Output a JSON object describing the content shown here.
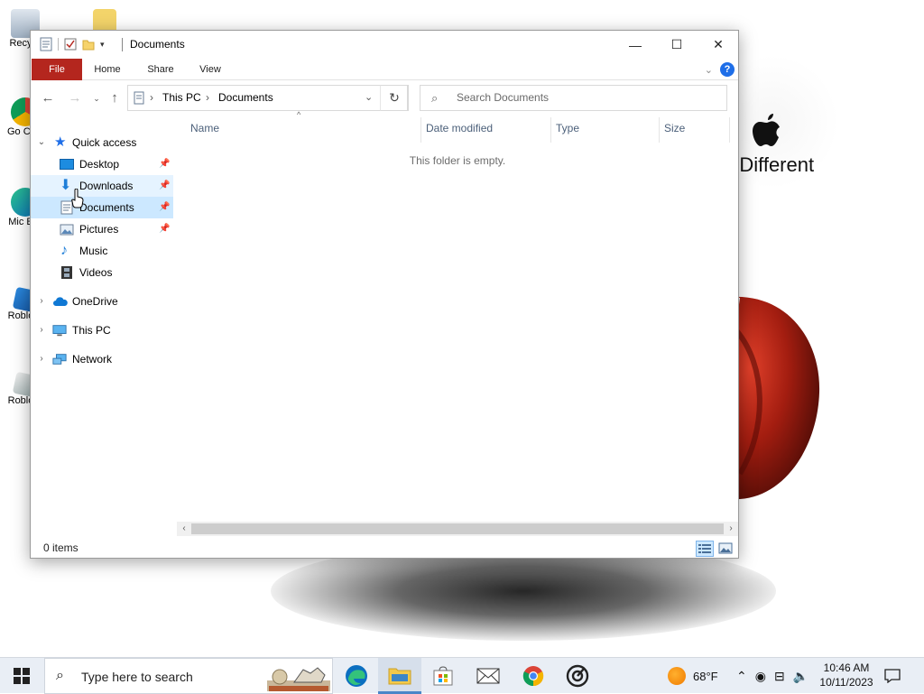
{
  "desktop": {
    "icons": [
      {
        "label": "Recy",
        "name": "recycle-bin"
      },
      {
        "label": "Go Chr",
        "name": "google-chrome"
      },
      {
        "label": "Mic E",
        "name": "microsoft-edge"
      },
      {
        "label": "Roblo",
        "name": "roblox-player"
      },
      {
        "label": "Roblo",
        "name": "roblox-studio"
      }
    ],
    "wallpaper_text": "nk Different"
  },
  "window": {
    "title": "Documents",
    "controls": {
      "minimize": "—",
      "maximize": "☐",
      "close": "✕"
    },
    "ribbon_tabs": [
      "File",
      "Home",
      "Share",
      "View"
    ],
    "help_label": "?",
    "address": {
      "root_label": "This PC",
      "current_label": "Documents",
      "separator": "›"
    },
    "search_placeholder": "Search Documents",
    "nav_pane": [
      {
        "label": "Quick access",
        "level": 0,
        "icon": "star-icon",
        "expanded": true
      },
      {
        "label": "Desktop",
        "level": 1,
        "icon": "desktop-folder-icon",
        "pinned": true
      },
      {
        "label": "Downloads",
        "level": 1,
        "icon": "download-arrow-icon",
        "pinned": true,
        "state": "hover"
      },
      {
        "label": "Documents",
        "level": 1,
        "icon": "documents-folder-icon",
        "pinned": true,
        "state": "selected"
      },
      {
        "label": "Pictures",
        "level": 1,
        "icon": "pictures-folder-icon",
        "pinned": true
      },
      {
        "label": "Music",
        "level": 1,
        "icon": "music-note-icon"
      },
      {
        "label": "Videos",
        "level": 1,
        "icon": "videos-folder-icon"
      },
      {
        "label": "OneDrive",
        "level": 0,
        "icon": "onedrive-cloud-icon"
      },
      {
        "label": "This PC",
        "level": 0,
        "icon": "computer-icon"
      },
      {
        "label": "Network",
        "level": 0,
        "icon": "network-icon"
      }
    ],
    "columns": [
      "Name",
      "Date modified",
      "Type",
      "Size"
    ],
    "empty_message": "This folder is empty.",
    "status": "0 items"
  },
  "taskbar": {
    "search_placeholder": "Type here to search",
    "apps": [
      "edge",
      "file-explorer",
      "microsoft-store",
      "mail",
      "chrome",
      "groove"
    ],
    "active_app": "file-explorer",
    "weather": "68°F",
    "time": "10:46 AM",
    "date": "10/11/2023"
  },
  "colors": {
    "file_tab": "#b4261e",
    "selection": "#cce8ff",
    "hover": "#e5f3ff",
    "accent": "#1e6ee8"
  }
}
